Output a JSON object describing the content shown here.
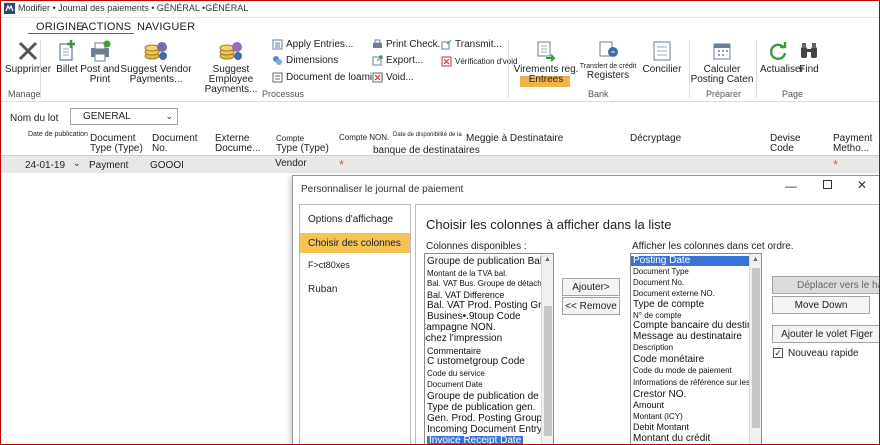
{
  "window": {
    "title": "Modifier • Journal des paiements • GÉNÉRAL •GÉNÉRAL"
  },
  "menu": {
    "tabs": [
      "ORIGINE",
      "ACTIONS",
      "NAVIGUER"
    ]
  },
  "ribbon": {
    "supprimer": "Supprimer",
    "billet": "Billet",
    "post_print_1": "Post and",
    "post_print_2": "Print",
    "suggest_vendor_1": "Suggest Vendor",
    "suggest_vendor_2": "Payments...",
    "suggest_employee_1": "Suggest Employee",
    "suggest_employee_2": "Payments...",
    "apply_entries": "Apply Entries...",
    "dimensions": "Dimensions",
    "document_loaming": "Document de loaming",
    "print_check": "Print Check...",
    "export": "Export...",
    "void": "Void...",
    "transmit": "Transmit...",
    "verification_void": "Vérification d'void",
    "virements_1": "Virements reg.",
    "virements_2": "Entrees",
    "transfert_1": "Transfert de crédit",
    "transfert_2": "Registers",
    "concilier": "Concilier",
    "calculer_1": "Calculer",
    "calculer_2": "Posting Caten",
    "actualiser": "Actualiser",
    "find": "Find",
    "groups": {
      "manage": "Manage",
      "processus": "Processus",
      "bank": "Bank",
      "preparer": "Préparer",
      "page": "Page"
    }
  },
  "lot": {
    "label": "Nom du lot",
    "value": "GENERAL"
  },
  "grid": {
    "headers": {
      "date_publication": "Date de publication",
      "doc_type_1": "Document",
      "doc_type_2": "Type (Type)",
      "doc_no_1": "Document",
      "doc_no_2": "No.",
      "externe_1": "Externe",
      "externe_2": "Docume...",
      "compte_type_1": "Compte",
      "compte_type_2": "Type (Type)",
      "compte_non": "Compte NON.",
      "disponibilite": "Date de disponibilité de la",
      "banque": "banque de destinataires",
      "meggie": "Meggie à Destinataire",
      "decryptage": "Décryptage",
      "devise_1": "Devise",
      "devise_2": "Code",
      "payment_1": "Payment",
      "payment_2": "Metho..."
    },
    "row": {
      "date": "24-01-19",
      "doc_type": "Payment",
      "doc_no": "GOOOI",
      "account_type": "Vendor",
      "required_mark": "*"
    }
  },
  "dialog": {
    "title": "Personnaliser le journal de paiement",
    "nav": [
      "Options d'affichage",
      "Choisir des colonnes",
      "F>ct80xes",
      "Ruban"
    ],
    "heading": "Choisir les colonnes à afficher dans la liste",
    "available_label": "Colonnes disponibles :",
    "shown_label": "Afficher les colonnes dans cet ordre.",
    "available": [
      "Groupe de publication Bal. Gen. Prod.",
      "Montant de la TVA bal.",
      "Bal. VAT Bus. Groupe de détachement",
      "Bal. VAT Difference",
      "Bal. VAT Prod. Posting Group",
      "Busines•.9toup Code",
      "Campagne NON.",
      "Cochez l'impression",
      "Commentaire",
      "C ustometgroup Code",
      "Code du service",
      "Document Date",
      "Groupe de publication de la génération Bus.",
      "Type de publication gen.",
      "Gen. Prod. Posting Group",
      "Incoming Document Entry No",
      "Invoice Receipt Date"
    ],
    "shown": [
      "Posting Date",
      "Document Type",
      "Document No.",
      "Document externe NO.",
      "Type de compte",
      "N° de compte",
      "Compte bancaire du destinataire",
      "Message au destinataire",
      "Description",
      "Code monétaire",
      "Code du mode de paiement",
      "Informations de référence sur les paiements",
      "Crestor NO.",
      "Amount",
      "Montant (ICY)",
      "Debit Montant",
      "Montant du crédit"
    ],
    "add_button": "Ajouter>",
    "remove_button": "<< Remove",
    "move_up_button": "Déplacer vers le haut",
    "move_down_button": "Move Down",
    "add_figure_button": "Ajouter le volet Figer",
    "checkbox_label": "Nouveau rapide",
    "checkbox_checked": true
  },
  "colors": {
    "accent": "#2e75b6",
    "selected_nav": "#f6c253",
    "list_selection": "#3874d8",
    "required": "#e05a2b",
    "frame": "#c00000"
  }
}
